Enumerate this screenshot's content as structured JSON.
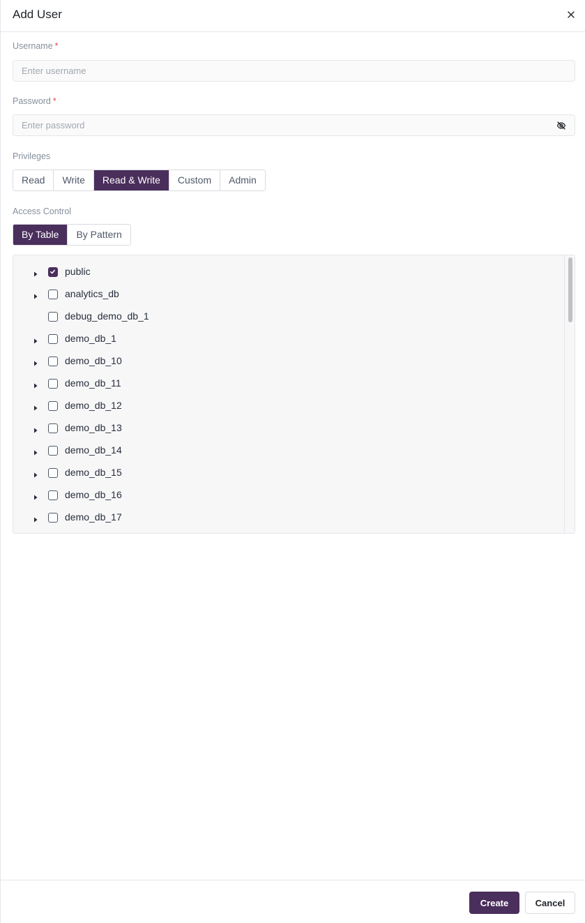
{
  "header": {
    "title": "Add User"
  },
  "username": {
    "label": "Username",
    "required": "*",
    "placeholder": "Enter username",
    "value": ""
  },
  "password": {
    "label": "Password",
    "required": "*",
    "placeholder": "Enter password",
    "value": ""
  },
  "privileges": {
    "label": "Privileges",
    "options": [
      "Read",
      "Write",
      "Read & Write",
      "Custom",
      "Admin"
    ],
    "selected": "Read & Write"
  },
  "access_control": {
    "label": "Access Control",
    "modes": [
      "By Table",
      "By Pattern"
    ],
    "selected": "By Table"
  },
  "tree": {
    "items": [
      {
        "label": "public",
        "checked": true,
        "expandable": true
      },
      {
        "label": "analytics_db",
        "checked": false,
        "expandable": true
      },
      {
        "label": "debug_demo_db_1",
        "checked": false,
        "expandable": false
      },
      {
        "label": "demo_db_1",
        "checked": false,
        "expandable": true
      },
      {
        "label": "demo_db_10",
        "checked": false,
        "expandable": true
      },
      {
        "label": "demo_db_11",
        "checked": false,
        "expandable": true
      },
      {
        "label": "demo_db_12",
        "checked": false,
        "expandable": true
      },
      {
        "label": "demo_db_13",
        "checked": false,
        "expandable": true
      },
      {
        "label": "demo_db_14",
        "checked": false,
        "expandable": true
      },
      {
        "label": "demo_db_15",
        "checked": false,
        "expandable": true
      },
      {
        "label": "demo_db_16",
        "checked": false,
        "expandable": true
      },
      {
        "label": "demo_db_17",
        "checked": false,
        "expandable": true
      }
    ]
  },
  "footer": {
    "create_label": "Create",
    "cancel_label": "Cancel"
  },
  "colors": {
    "accent": "#4a2e5c",
    "required": "#e5484d"
  },
  "icons": {
    "close": "close-icon",
    "eye": "eye-off-icon",
    "caret": "caret-right-icon",
    "check": "check-icon"
  }
}
